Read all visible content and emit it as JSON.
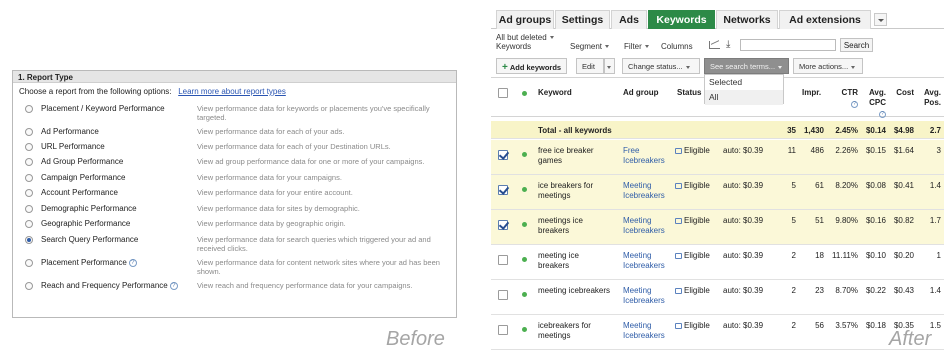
{
  "before": {
    "header": "1. Report Type",
    "prompt": "Choose a report from the following options:",
    "prompt_link": "Learn more about report types",
    "options": [
      {
        "label": "Placement / Keyword Performance",
        "desc": "View performance data for keywords or placements you've specifically targeted.",
        "checked": false,
        "help": false
      },
      {
        "label": "Ad Performance",
        "desc": "View performance data for each of your ads.",
        "checked": false,
        "help": false
      },
      {
        "label": "URL Performance",
        "desc": "View performance data for each of your Destination URLs.",
        "checked": false,
        "help": false
      },
      {
        "label": "Ad Group Performance",
        "desc": "View ad group performance data for one or more of your campaigns.",
        "checked": false,
        "help": false
      },
      {
        "label": "Campaign Performance",
        "desc": "View performance data for your campaigns.",
        "checked": false,
        "help": false
      },
      {
        "label": "Account Performance",
        "desc": "View performance data for your entire account.",
        "checked": false,
        "help": false
      },
      {
        "label": "Demographic Performance",
        "desc": "View performance data for sites by demographic.",
        "checked": false,
        "help": false
      },
      {
        "label": "Geographic Performance",
        "desc": "View performance data by geographic origin.",
        "checked": false,
        "help": false
      },
      {
        "label": "Search Query Performance",
        "desc": "View performance data for search queries which triggered your ad and received clicks.",
        "checked": true,
        "help": false
      },
      {
        "label": "Placement Performance",
        "desc": "View performance data for content network sites where your ad has been shown.",
        "checked": false,
        "help": true
      },
      {
        "label": "Reach and Frequency Performance",
        "desc": "View reach and frequency performance data for your campaigns.",
        "checked": false,
        "help": true
      }
    ],
    "caption": "Before"
  },
  "after": {
    "tabs": [
      "Ad groups",
      "Settings",
      "Ads",
      "Keywords",
      "Networks",
      "Ad extensions"
    ],
    "active_tab": "Keywords",
    "filter": {
      "scope_line1": "All but deleted",
      "scope_line2": "Keywords",
      "segment": "Segment",
      "filter": "Filter",
      "columns": "Columns",
      "search_button": "Search",
      "search_value": ""
    },
    "toolbar": {
      "add": "Add keywords",
      "edit": "Edit",
      "change_status": "Change status...",
      "see_search_terms": "See search terms...",
      "more_actions": "More actions..."
    },
    "dropdown": [
      "Selected",
      "All"
    ],
    "columns": {
      "keyword": "Keyword",
      "ad_group": "Ad group",
      "status": "Status",
      "impr": "Impr.",
      "ctr": "CTR",
      "avg_cpc_1": "Avg.",
      "avg_cpc_2": "CPC",
      "cost": "Cost",
      "avg_pos_1": "Avg.",
      "avg_pos_2": "Pos."
    },
    "total": {
      "label": "Total - all keywords",
      "clicks": "35",
      "impr": "1,430",
      "ctr": "2.45%",
      "cpc": "$0.14",
      "cost": "$4.98",
      "pos": "2.7"
    },
    "rows": [
      {
        "kw1": "free ice breaker",
        "kw2": "games",
        "ag1": "Free",
        "ag2": "Icebreakers",
        "status": "Eligible",
        "bid": "auto: $0.39",
        "clicks": "11",
        "impr": "486",
        "ctr": "2.26%",
        "cpc": "$0.15",
        "cost": "$1.64",
        "pos": "3",
        "checked": true
      },
      {
        "kw1": "ice breakers for",
        "kw2": "meetings",
        "ag1": "Meeting",
        "ag2": "Icebreakers",
        "status": "Eligible",
        "bid": "auto: $0.39",
        "clicks": "5",
        "impr": "61",
        "ctr": "8.20%",
        "cpc": "$0.08",
        "cost": "$0.41",
        "pos": "1.4",
        "checked": true
      },
      {
        "kw1": "meetings ice",
        "kw2": "breakers",
        "ag1": "Meeting",
        "ag2": "Icebreakers",
        "status": "Eligible",
        "bid": "auto: $0.39",
        "clicks": "5",
        "impr": "51",
        "ctr": "9.80%",
        "cpc": "$0.16",
        "cost": "$0.82",
        "pos": "1.7",
        "checked": true
      },
      {
        "kw1": "meeting ice",
        "kw2": "breakers",
        "ag1": "Meeting",
        "ag2": "Icebreakers",
        "status": "Eligible",
        "bid": "auto: $0.39",
        "clicks": "2",
        "impr": "18",
        "ctr": "11.11%",
        "cpc": "$0.10",
        "cost": "$0.20",
        "pos": "1",
        "checked": false
      },
      {
        "kw1": "meeting icebreakers",
        "kw2": "",
        "ag1": "Meeting",
        "ag2": "Icebreakers",
        "status": "Eligible",
        "bid": "auto: $0.39",
        "clicks": "2",
        "impr": "23",
        "ctr": "8.70%",
        "cpc": "$0.22",
        "cost": "$0.43",
        "pos": "1.4",
        "checked": false
      },
      {
        "kw1": "icebreakers for",
        "kw2": "meetings",
        "ag1": "Meeting",
        "ag2": "Icebreakers",
        "status": "Eligible",
        "bid": "auto: $0.39",
        "clicks": "2",
        "impr": "56",
        "ctr": "3.57%",
        "cpc": "$0.18",
        "cost": "$0.35",
        "pos": "1.5",
        "checked": false
      }
    ],
    "caption": "After"
  }
}
